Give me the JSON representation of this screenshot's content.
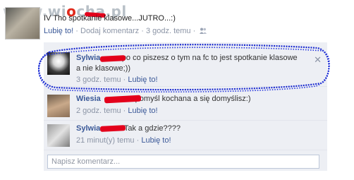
{
  "watermark": {
    "www": "www.",
    "wi": "wi",
    "o": "o",
    "cha": "cha",
    "pl": ".pl"
  },
  "post": {
    "text": "IV Tho spotkanie klasowe...JUTRO...:)",
    "like_label": "Lubię to!",
    "comment_label": "Dodaj komentarz",
    "time": "3 godz. temu",
    "separator": "·",
    "audience_icon": "people-icon"
  },
  "comments": [
    {
      "name": "Sylwia",
      "text_line1": "po co piszesz o tym na fc to jest spotkanie klasowe",
      "text_line2": "a nie klasowe;))",
      "time": "3 godz. temu",
      "like_label": "Lubię to!",
      "close_label": "✕"
    },
    {
      "name": "Wiesia",
      "text_line1": "pomyśl kochana a się domyślisz:)",
      "time": "2 godz. temu",
      "like_label": "Lubię to!"
    },
    {
      "name": "Sylwia",
      "text_line1": "Tak a gdzie????",
      "time": "21 minut(y) temu",
      "like_label": "Lubię to!"
    }
  ],
  "comment_input": {
    "placeholder": "Napisz komentarz..."
  },
  "colors": {
    "link": "#3b5998",
    "meta": "#8c95a6",
    "comments_bg": "#edeff4",
    "scribble": "#1a2ad0",
    "redaction": "#e3001b"
  }
}
